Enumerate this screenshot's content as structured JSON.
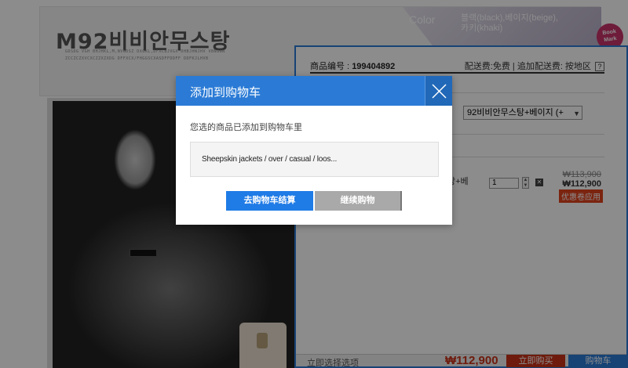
{
  "brand": {
    "title": "M92비비안무스탕",
    "tagline_1": "GDSDG VGH BHJHKL,M,NVGDSZ DXGKL,DFXCBJVGX DHBJHNJHV VBNGGN",
    "tagline_2": "ZCCZCZXVCXCZZXZXDG DFFXCX/FHGGSCXASDFFDDFF DDFKJLHVB"
  },
  "color_info": {
    "label": "Color",
    "values": "블랙(black),베이지(beige),\n카키(khaki)"
  },
  "bookmark": {
    "label_1": "Book",
    "label_2": "Mark"
  },
  "order_panel": {
    "product_code_label": "商品编号 :",
    "product_code": "199404892",
    "shipping_text": "配送费:免费 | 追加配送费: 按地区",
    "help_icon": "?",
    "option_selected": "92비비안무스탕+베이지 (+",
    "cart_item_name_part": "탕+베",
    "quantity": "1",
    "price_original": "₩113,900",
    "price_current": "₩112,900",
    "coupon_label": "优惠卷应用",
    "bottom_label": "立即选择选项",
    "bottom_total": "₩112,900",
    "buy_now_label": "立即购买",
    "cart_label": "购物车"
  },
  "modal": {
    "title": "添加到购物车",
    "message": "您选的商品已添加到购物车里",
    "item_name": "Sheepskin jackets / over / casual / loos...",
    "checkout_label": "去购物车结算",
    "continue_label": "继续购物"
  },
  "colors": {
    "accent": "#2b7bd6",
    "price_red": "#c83218",
    "overlay": "rgba(0,0,0,0.45)"
  }
}
